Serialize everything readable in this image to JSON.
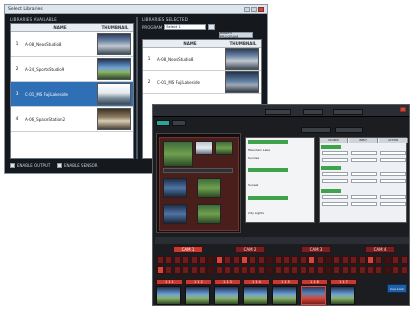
{
  "library_window": {
    "title": "Select Libraries",
    "available_header": "LIBRARIES AVAILABLE",
    "selected_header": "LIBRARIES SELECTED",
    "col_name": "NAME",
    "col_thumb": "THUMBNAIL",
    "available": [
      {
        "num": "1",
        "name": "A-08_NeosStudio8"
      },
      {
        "num": "2",
        "name": "A-24_SportsStudio9"
      },
      {
        "num": "3",
        "name": "C-01_MS FujiLakeside",
        "selected": true
      },
      {
        "num": "4",
        "name": "A-06_SpaceStation2"
      }
    ],
    "program_label": "PROGRAM",
    "program_value": "Select 1",
    "insert_button": "INSERT PROGRAM",
    "selected": [
      {
        "num": "1",
        "name": "A-08_NeosStudio8"
      },
      {
        "num": "2",
        "name": "C-01_MS FujiLakeside"
      }
    ],
    "enable_output": "ENABLE OUTPUT",
    "enable_sensor": "ENABLE SENSOR"
  },
  "main_window": {
    "tabs": [
      "SOURCE",
      "PRESET",
      "SETTINGS"
    ],
    "banks": [
      "CAM 1",
      "CAM 2",
      "CAM 3",
      "CAM 4"
    ],
    "tree_rows": [
      "Mountain Lake",
      "Sunrise",
      "Sunset",
      "City Lights"
    ],
    "grid_headers": [
      "SOURCE",
      "INPUT",
      "ACTION"
    ],
    "preset_labels": [
      "PRESET 1",
      "PRESET 2",
      "PRESET 3",
      "PRESET 4"
    ],
    "cues": [
      "1 1 1",
      "1 1 2",
      "1 1 3",
      "1 1 4",
      "1 1 5",
      "1 1 6",
      "1 1 7"
    ],
    "cue_button": "Cue Lock"
  }
}
